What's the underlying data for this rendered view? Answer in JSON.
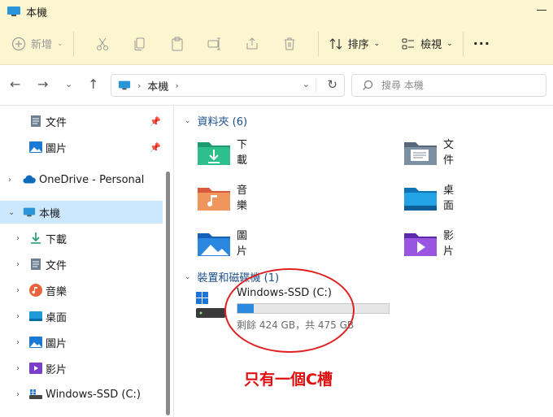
{
  "window": {
    "title": "本機"
  },
  "ribbon": {
    "new_label": "新增",
    "sort_label": "排序",
    "view_label": "檢視",
    "more_label": "···"
  },
  "address": {
    "location": "本機",
    "search_placeholder": "搜尋 本機"
  },
  "sidebar": {
    "pinned": [
      {
        "label": "文件",
        "icon": "documents-icon"
      },
      {
        "label": "圖片",
        "icon": "pictures-icon"
      }
    ],
    "onedrive": "OneDrive - Personal",
    "this_pc": "本機",
    "children": [
      {
        "label": "下載",
        "icon": "download-icon"
      },
      {
        "label": "文件",
        "icon": "documents-icon"
      },
      {
        "label": "音樂",
        "icon": "music-icon"
      },
      {
        "label": "桌面",
        "icon": "desktop-icon"
      },
      {
        "label": "圖片",
        "icon": "pictures-icon"
      },
      {
        "label": "影片",
        "icon": "videos-icon"
      },
      {
        "label": "Windows-SSD (C:)",
        "icon": "drive-icon"
      }
    ]
  },
  "content": {
    "folders_header": "資料夾 (6)",
    "folders": [
      {
        "label": "下載",
        "icon": "download-folder-icon"
      },
      {
        "label": "文件",
        "icon": "documents-folder-icon"
      },
      {
        "label": "音樂",
        "icon": "music-folder-icon"
      },
      {
        "label": "桌面",
        "icon": "desktop-folder-icon"
      },
      {
        "label": "圖片",
        "icon": "pictures-folder-icon"
      },
      {
        "label": "影片",
        "icon": "videos-folder-icon"
      }
    ],
    "drives_header": "裝置和磁碟機 (1)",
    "drive": {
      "name": "Windows-SSD (C:)",
      "free_text": "剩餘 424 GB，共 475 GB",
      "used_fraction": 0.107
    }
  },
  "annotation": {
    "text": "只有一個C槽"
  },
  "colors": {
    "ribbon_bg": "#fbf6cf",
    "selected_bg": "#cce8ff",
    "drive_bar": "#2b8ae0",
    "annotation_red": "#e02020"
  }
}
